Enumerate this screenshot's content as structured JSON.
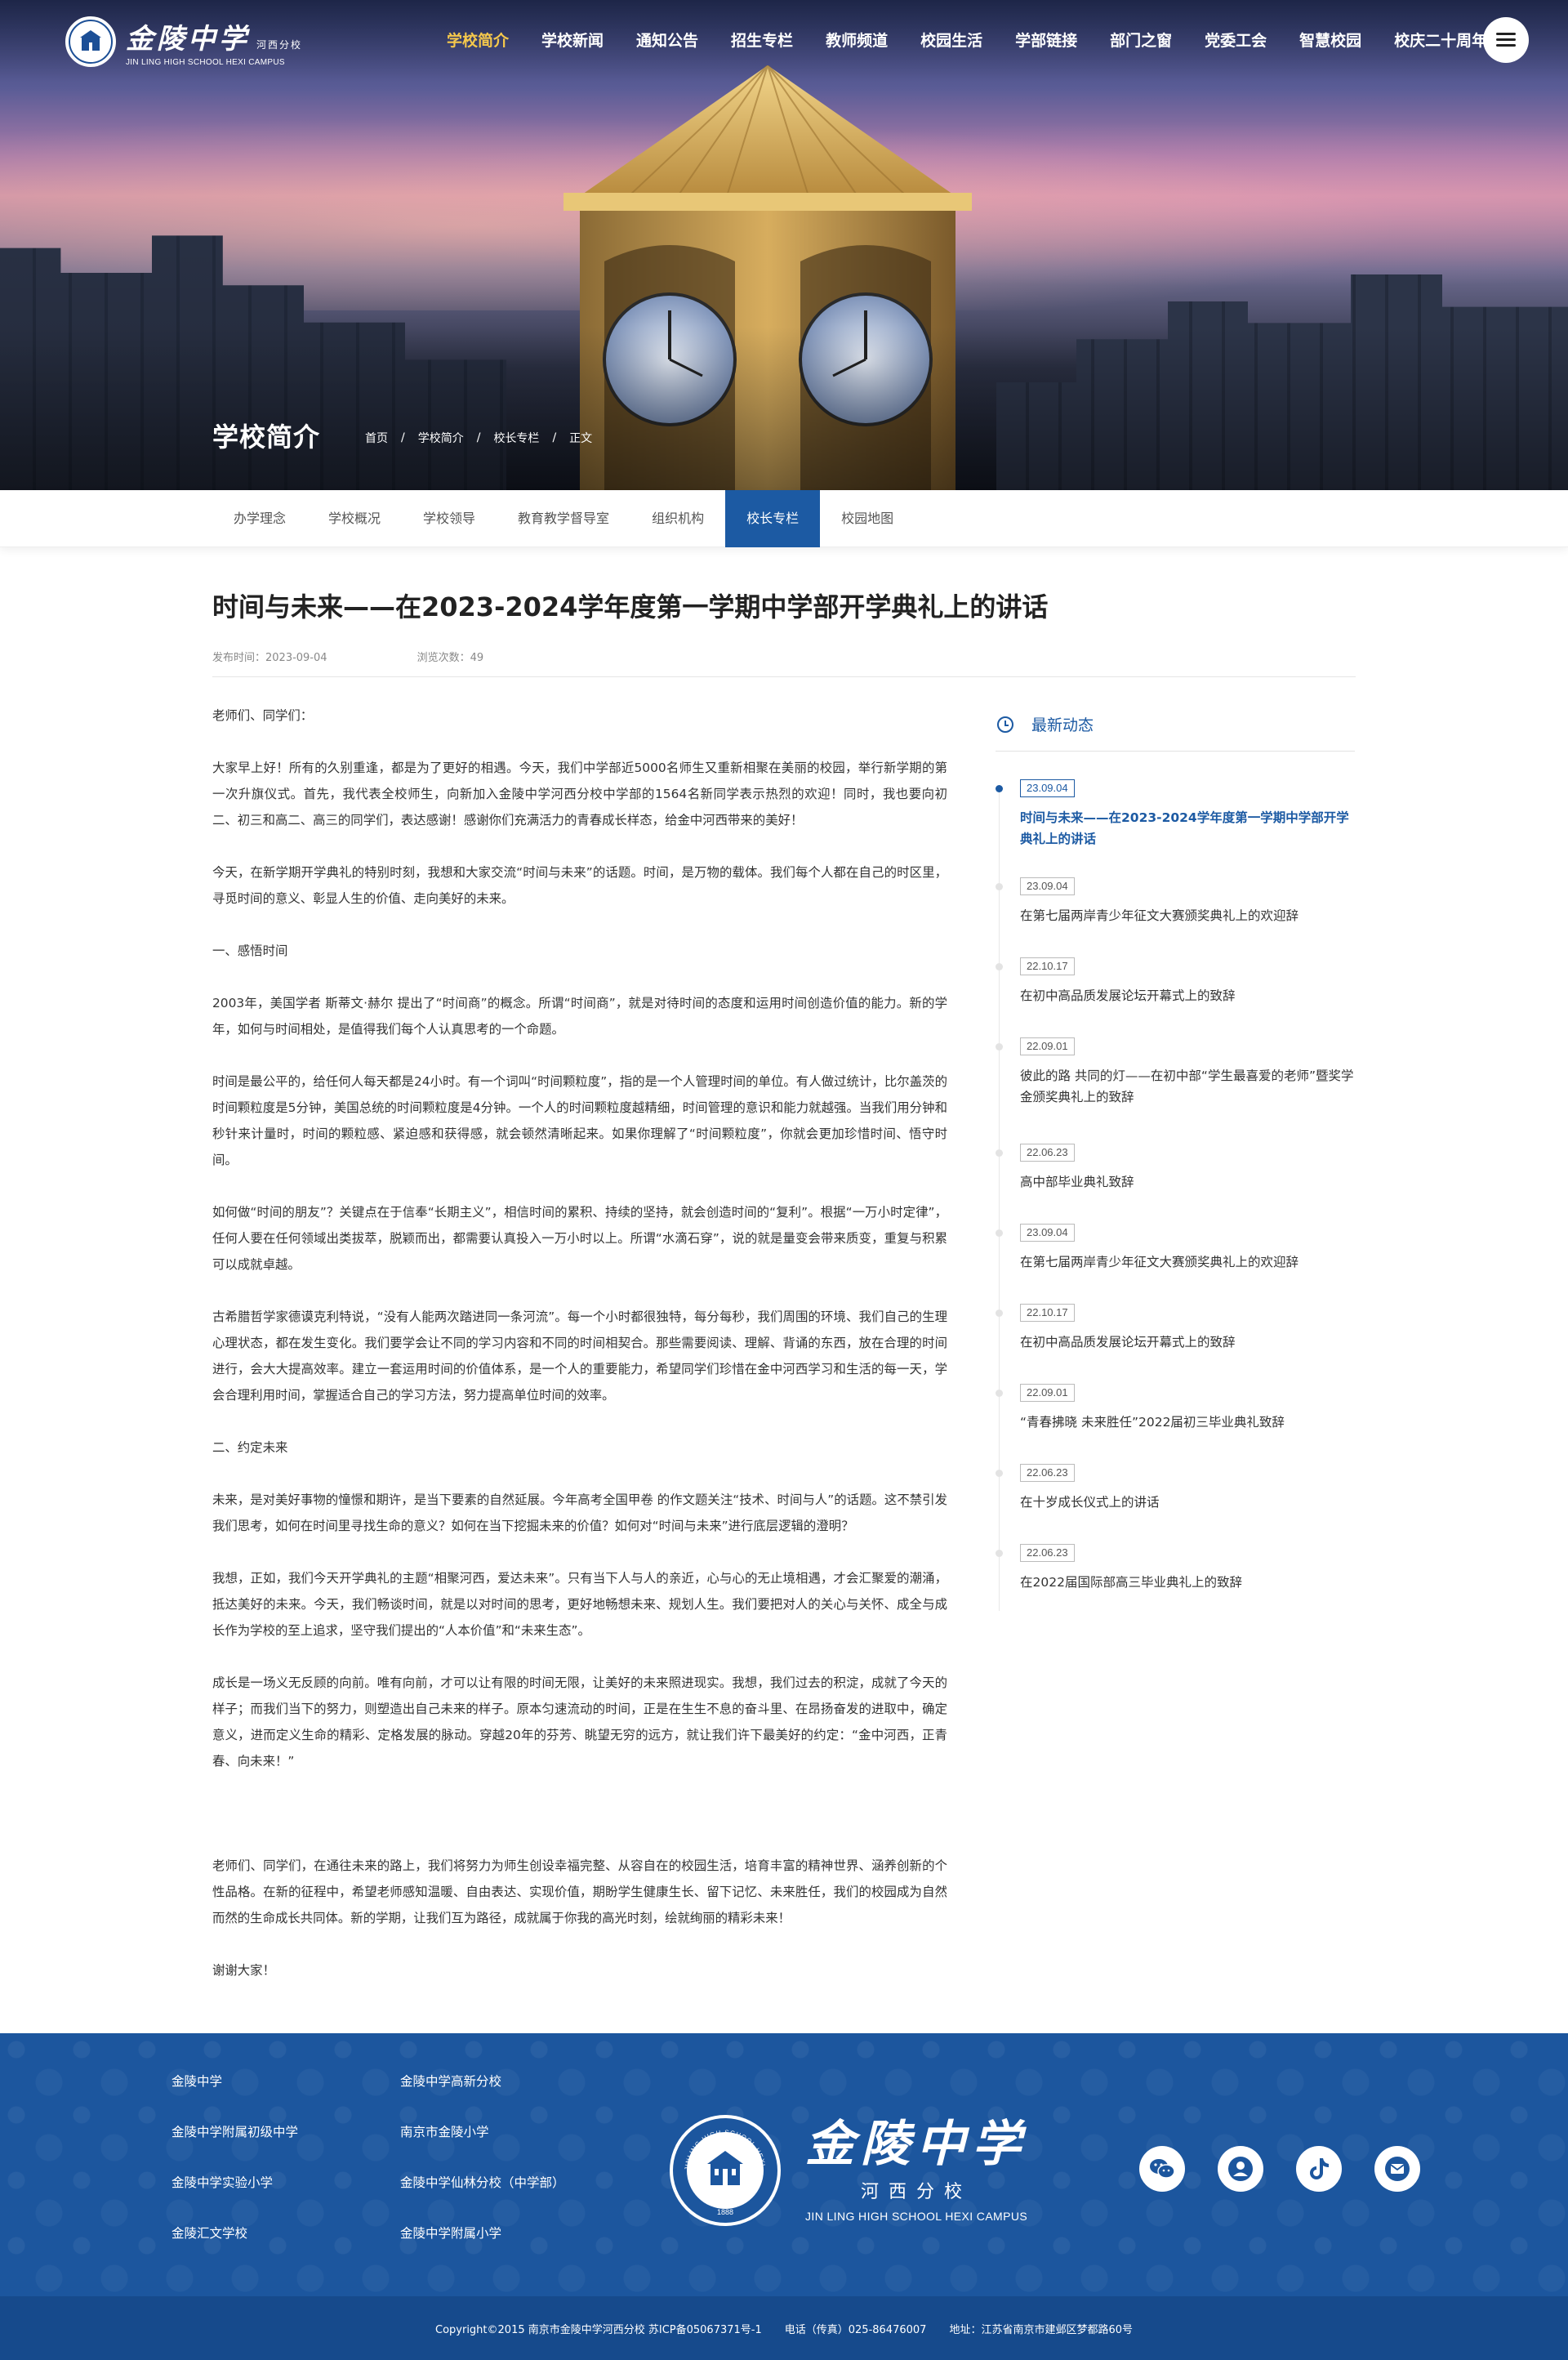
{
  "header": {
    "logo_cn": "金陵中学",
    "logo_branch": "河西分校",
    "logo_en": "JIN LING HIGH SCHOOL HEXI CAMPUS",
    "nav": [
      {
        "label": "学校简介",
        "active": true
      },
      {
        "label": "学校新闻",
        "active": false
      },
      {
        "label": "通知公告",
        "active": false
      },
      {
        "label": "招生专栏",
        "active": false
      },
      {
        "label": "教师频道",
        "active": false
      },
      {
        "label": "校园生活",
        "active": false
      },
      {
        "label": "学部链接",
        "active": false
      },
      {
        "label": "部门之窗",
        "active": false
      },
      {
        "label": "党委工会",
        "active": false
      },
      {
        "label": "智慧校园",
        "active": false
      },
      {
        "label": "校庆二十周年",
        "active": false
      }
    ],
    "menu_icon": "hamburger-menu-icon"
  },
  "hero": {
    "title": "学校简介",
    "breadcrumb": [
      "首页",
      "学校简介",
      "校长专栏",
      "正文"
    ],
    "breadcrumb_sep": "/"
  },
  "subnav": [
    {
      "label": "办学理念",
      "active": false
    },
    {
      "label": "学校概况",
      "active": false
    },
    {
      "label": "学校领导",
      "active": false
    },
    {
      "label": "教育教学督导室",
      "active": false
    },
    {
      "label": "组织机构",
      "active": false
    },
    {
      "label": "校长专栏",
      "active": true
    },
    {
      "label": "校园地图",
      "active": false
    }
  ],
  "article": {
    "title": "时间与未来——在2023-2024学年度第一学期中学部开学典礼上的讲话",
    "publish_label": "发布时间：2023-09-04",
    "views_label": "浏览次数：49",
    "paragraphs": [
      "老师们、同学们：",
      "大家早上好！所有的久别重逢，都是为了更好的相遇。今天，我们中学部近5000名师生又重新相聚在美丽的校园，举行新学期的第一次升旗仪式。首先，我代表全校师生，向新加入金陵中学河西分校中学部的1564名新同学表示热烈的欢迎！同时，我也要向初二、初三和高二、高三的同学们，表达感谢！感谢你们充满活力的青春成长样态，给金中河西带来的美好！",
      "今天，在新学期开学典礼的特别时刻，我想和大家交流“时间与未来”的话题。时间，是万物的载体。我们每个人都在自己的时区里，寻觅时间的意义、彰显人生的价值、走向美好的未来。",
      "一、感悟时间",
      "2003年，美国学者 斯蒂文·赫尔 提出了“时间商”的概念。所谓“时间商”，就是对待时间的态度和运用时间创造价值的能力。新的学年，如何与时间相处，是值得我们每个人认真思考的一个命题。",
      "时间是最公平的，给任何人每天都是24小时。有一个词叫“时间颗粒度”，指的是一个人管理时间的单位。有人做过统计，比尔盖茨的时间颗粒度是5分钟，美国总统的时间颗粒度是4分钟。一个人的时间颗粒度越精细，时间管理的意识和能力就越强。当我们用分钟和秒针来计量时，时间的颗粒感、紧迫感和获得感，就会顿然清晰起来。如果你理解了“时间颗粒度”，你就会更加珍惜时间、悟守时间。",
      "如何做“时间的朋友”？关键点在于信奉“长期主义”，相信时间的累积、持续的坚持，就会创造时间的“复利”。根据“一万小时定律”，任何人要在任何领域出类拔萃，脱颖而出，都需要认真投入一万小时以上。所谓“水滴石穿”，说的就是量变会带来质变，重复与积累可以成就卓越。",
      "古希腊哲学家德谟克利特说，“没有人能两次踏进同一条河流”。每一个小时都很独特，每分每秒，我们周围的环境、我们自己的生理心理状态，都在发生变化。我们要学会让不同的学习内容和不同的时间相契合。那些需要阅读、理解、背诵的东西，放在合理的时间进行，会大大提高效率。建立一套运用时间的价值体系，是一个人的重要能力，希望同学们珍惜在金中河西学习和生活的每一天，学会合理利用时间，掌握适合自己的学习方法，努力提高单位时间的效率。",
      "二、约定未来",
      "未来，是对美好事物的憧憬和期许，是当下要素的自然延展。今年高考全国甲卷 的作文题关注“技术、时间与人”的话题。这不禁引发我们思考，如何在时间里寻找生命的意义？如何在当下挖掘未来的价值？如何对“时间与未来”进行底层逻辑的澄明？",
      "我想，正如，我们今天开学典礼的主题“相聚河西，爱达未来”。只有当下人与人的亲近，心与心的无止境相遇，才会汇聚爱的潮涌，抵达美好的未来。今天，我们畅谈时间，就是以对时间的思考，更好地畅想未来、规划人生。我们要把对人的关心与关怀、成全与成长作为学校的至上追求，坚守我们提出的“人本价值”和“未来生态”。",
      "成长是一场义无反顾的向前。唯有向前，才可以让有限的时间无限，让美好的未来照进现实。我想，我们过去的积淀，成就了今天的样子；而我们当下的努力，则塑造出自己未来的样子。原本匀速流动的时间，正是在生生不息的奋斗里、在昂扬奋发的进取中，确定意义，进而定义生命的精彩、定格发展的脉动。穿越20年的芬芳、眺望无穷的远方，就让我们许下最美好的约定：“金中河西，正青春、向未来！”",
      "老师们、同学们，在通往未来的路上，我们将努力为师生创设幸福完整、从容自在的校园生活，培育丰富的精神世界、涵养创新的个性品格。在新的征程中，希望老师感知温暖、自由表达、实现价值，期盼学生健康生长、留下记忆、未来胜任，我们的校园成为自然而然的生命成长共同体。新的学期，让我们互为路径，成就属于你我的高光时刻，绘就绚丽的精彩未来！",
      "谢谢大家！"
    ]
  },
  "sidebar": {
    "heading": "最新动态",
    "heading_icon": "clock-icon",
    "items": [
      {
        "date": "23.09.04",
        "title": "时间与未来——在2023-2024学年度第一学期中学部开学典礼上的讲话",
        "active": true
      },
      {
        "date": "23.09.04",
        "title": "在第七届两岸青少年征文大赛颁奖典礼上的欢迎辞",
        "active": false
      },
      {
        "date": "22.10.17",
        "title": "在初中高品质发展论坛开幕式上的致辞",
        "active": false
      },
      {
        "date": "22.09.01",
        "title": "彼此的路 共同的灯——在初中部“学生最喜爱的老师”暨奖学金颁奖典礼上的致辞",
        "active": false
      },
      {
        "date": "22.06.23",
        "title": "高中部毕业典礼致辞",
        "active": false
      },
      {
        "date": "23.09.04",
        "title": "在第七届两岸青少年征文大赛颁奖典礼上的欢迎辞",
        "active": false
      },
      {
        "date": "22.10.17",
        "title": "在初中高品质发展论坛开幕式上的致辞",
        "active": false
      },
      {
        "date": "22.09.01",
        "title": "“青春拂晓 未来胜任”2022届初三毕业典礼致辞",
        "active": false
      },
      {
        "date": "22.06.23",
        "title": "在十岁成长仪式上的讲话",
        "active": false
      },
      {
        "date": "22.06.23",
        "title": "在2022届国际部高三毕业典礼上的致辞",
        "active": false
      }
    ]
  },
  "footer": {
    "links": [
      "金陵中学",
      "金陵中学高新分校",
      "金陵中学附属初级中学",
      "南京市金陵小学",
      "金陵中学实验小学",
      "金陵中学仙林分校（中学部）",
      "金陵汇文学校",
      "金陵中学附属小学"
    ],
    "logo_cn": "金陵中学",
    "logo_branch": "河西分校",
    "logo_en": "JIN LING HIGH SCHOOL HEXI CAMPUS",
    "seal_text": "JINLING HIGH SCHOOL HEXI CAMPUS",
    "seal_year": "1888",
    "socials": [
      "wechat-icon",
      "user-icon",
      "tiktok-icon",
      "mail-icon"
    ],
    "copyright": "Copyright©2015 南京市金陵中学河西分校  苏ICP备05067371号-1",
    "phone": "电话（传真）025-86476007",
    "address": "地址：江苏省南京市建邺区梦都路60号"
  },
  "colors": {
    "primary": "#1c5aa3",
    "footer_bg": "#1c569e",
    "nav_active": "#f5c84c"
  }
}
